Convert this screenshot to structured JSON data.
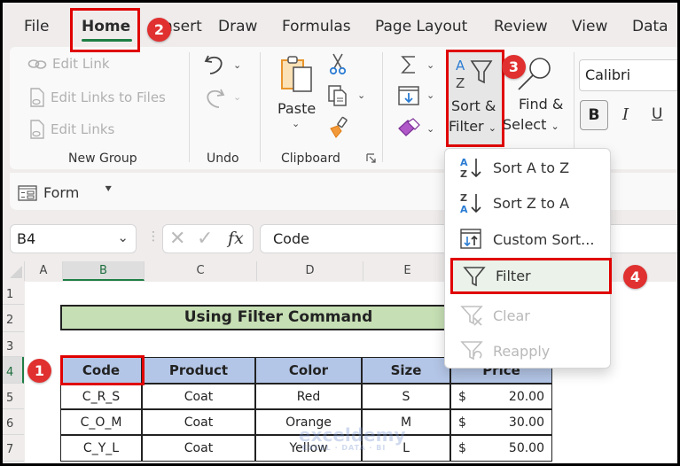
{
  "menu": {
    "tabs": [
      "File",
      "Home",
      "Insert",
      "Draw",
      "Formulas",
      "Page Layout",
      "Review",
      "View",
      "Data"
    ],
    "active": "Home"
  },
  "ribbon": {
    "new_group": {
      "label": "New Group",
      "items": [
        "Edit Link",
        "Edit Links to Files",
        "Edit Links"
      ]
    },
    "undo": {
      "label": "Undo"
    },
    "clipboard": {
      "label": "Clipboard",
      "paste": "Paste"
    },
    "editing": {
      "sort_filter_line1": "Sort &",
      "sort_filter_line2": "Filter",
      "find_select_line1": "Find &",
      "find_select_line2": "Select"
    },
    "font": {
      "name": "Calibri",
      "bold": "B",
      "italic": "I",
      "underline": "U"
    }
  },
  "quick_access": {
    "form": "Form"
  },
  "formula_bar": {
    "name_box": "B4",
    "fx": "fx",
    "content": "Code"
  },
  "columns": [
    "A",
    "B",
    "C",
    "D",
    "E"
  ],
  "rows": [
    "1",
    "2",
    "3",
    "4",
    "5",
    "6",
    "7"
  ],
  "sheet": {
    "title": "Using Filter Command",
    "headers": [
      "Code",
      "Product",
      "Color",
      "Size",
      "Price"
    ],
    "data": [
      {
        "code": "C_R_S",
        "product": "Coat",
        "color": "Red",
        "size": "S",
        "currency": "$",
        "price": "20.00"
      },
      {
        "code": "C_O_M",
        "product": "Coat",
        "color": "Orange",
        "size": "M",
        "currency": "$",
        "price": "30.00"
      },
      {
        "code": "C_Y_L",
        "product": "Coat",
        "color": "Yellow",
        "size": "L",
        "currency": "$",
        "price": "50.00"
      }
    ]
  },
  "dropdown": {
    "items": [
      {
        "label": "Sort A to Z",
        "enabled": true
      },
      {
        "label": "Sort Z to A",
        "enabled": true
      },
      {
        "label": "Custom Sort...",
        "enabled": true
      },
      {
        "label": "Filter",
        "enabled": true,
        "highlighted": true
      },
      {
        "label": "Clear",
        "enabled": false
      },
      {
        "label": "Reapply",
        "enabled": false
      }
    ]
  },
  "badges": [
    "1",
    "2",
    "3",
    "4"
  ],
  "watermark": {
    "brand": "exceldemy",
    "tagline": "EXCEL · DATA · BI"
  },
  "colors": {
    "highlight_red": "#e00000",
    "badge_red": "#e03030",
    "excel_green": "#1e7e44",
    "title_fill": "#c6dfb4",
    "header_fill": "#b4c6e7"
  }
}
